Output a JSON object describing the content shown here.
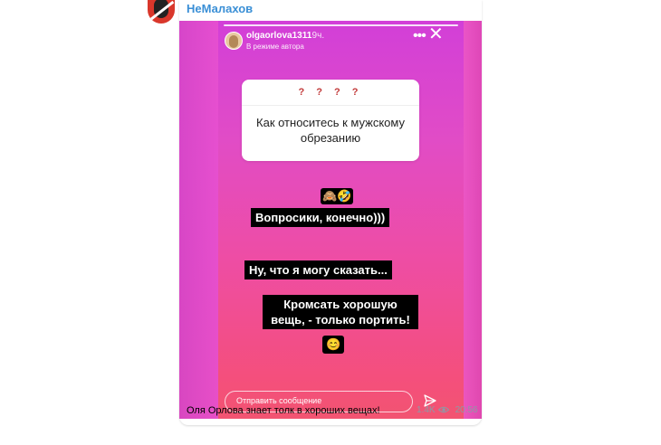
{
  "channel": {
    "name": "НеМалахов"
  },
  "story": {
    "username": "olgaorlova1311",
    "time": "19ч.",
    "mode": "В режиме автора",
    "question_marks": "? ? ? ?",
    "question_text": "Как относитесь к мужскому обрезанию",
    "emoji_row": "🙈🤣",
    "caption_1": "Вопросики, конечно)))",
    "caption_2": "Ну, что я могу сказать...",
    "caption_3": "Кромсать хорошую вещь, - только портить!",
    "emoji_2": "😊",
    "input_placeholder": "Отправить сообщение"
  },
  "message": {
    "text": "Оля Орлова знает толк в хороших вещах!",
    "views": "1.4K",
    "time": "20:56"
  },
  "icons": [
    "channel-avatar",
    "more-icon",
    "close-icon",
    "send-icon",
    "eye-icon"
  ]
}
